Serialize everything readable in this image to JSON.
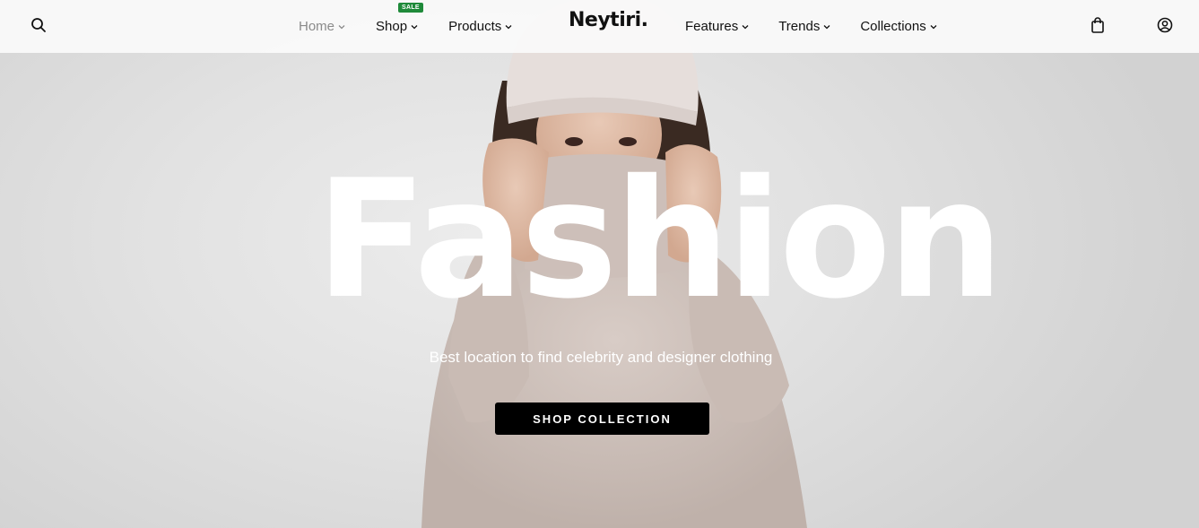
{
  "brand": {
    "logo": "Neytiri."
  },
  "nav_left": [
    {
      "label": "Home",
      "muted": true
    },
    {
      "label": "Shop",
      "badge": "SALE"
    },
    {
      "label": "Products"
    }
  ],
  "nav_right": [
    {
      "label": "Features"
    },
    {
      "label": "Trends"
    },
    {
      "label": "Collections"
    }
  ],
  "icons": {
    "search": "search-icon",
    "bag": "shopping-bag-icon",
    "account": "user-account-icon"
  },
  "hero": {
    "title": "Fashion",
    "subtitle": "Best location to find celebrity and designer clothing",
    "cta": "SHOP COLLECTION"
  },
  "colors": {
    "sale_badge": "#1f8a3a",
    "cta_bg": "#000000",
    "header_bg": "#fafafa"
  }
}
